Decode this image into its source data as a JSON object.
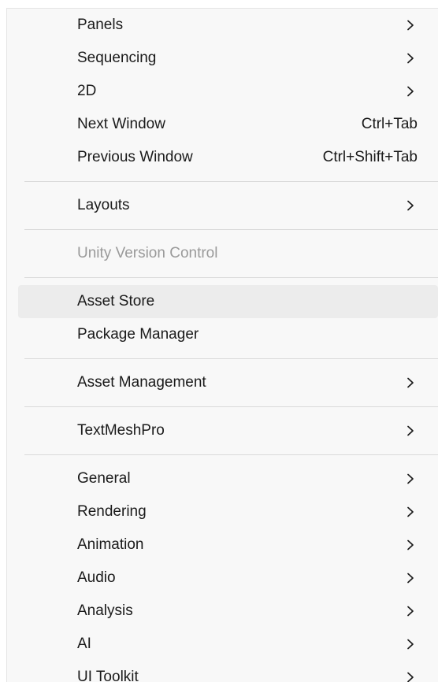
{
  "menu": {
    "groups": [
      {
        "items": [
          {
            "label": "Panels",
            "submenu": true
          },
          {
            "label": "Sequencing",
            "submenu": true
          },
          {
            "label": "2D",
            "submenu": true
          },
          {
            "label": "Next Window",
            "shortcut": "Ctrl+Tab"
          },
          {
            "label": "Previous Window",
            "shortcut": "Ctrl+Shift+Tab"
          }
        ]
      },
      {
        "items": [
          {
            "label": "Layouts",
            "submenu": true
          }
        ]
      },
      {
        "items": [
          {
            "label": "Unity Version Control",
            "disabled": true
          }
        ]
      },
      {
        "items": [
          {
            "label": "Asset Store",
            "highlighted": true
          },
          {
            "label": "Package Manager"
          }
        ]
      },
      {
        "items": [
          {
            "label": "Asset Management",
            "submenu": true
          }
        ]
      },
      {
        "items": [
          {
            "label": "TextMeshPro",
            "submenu": true
          }
        ]
      },
      {
        "items": [
          {
            "label": "General",
            "submenu": true
          },
          {
            "label": "Rendering",
            "submenu": true
          },
          {
            "label": "Animation",
            "submenu": true
          },
          {
            "label": "Audio",
            "submenu": true
          },
          {
            "label": "Analysis",
            "submenu": true
          },
          {
            "label": "AI",
            "submenu": true
          },
          {
            "label": "UI Toolkit",
            "submenu": true
          }
        ]
      }
    ],
    "icons": {
      "submenu": "chevron-right-icon"
    },
    "colors": {
      "background": "#f8f8f8",
      "highlight": "#ececec",
      "text": "#1a1a1a",
      "disabled_text": "#9a9a9a",
      "separator": "#dadada"
    }
  }
}
